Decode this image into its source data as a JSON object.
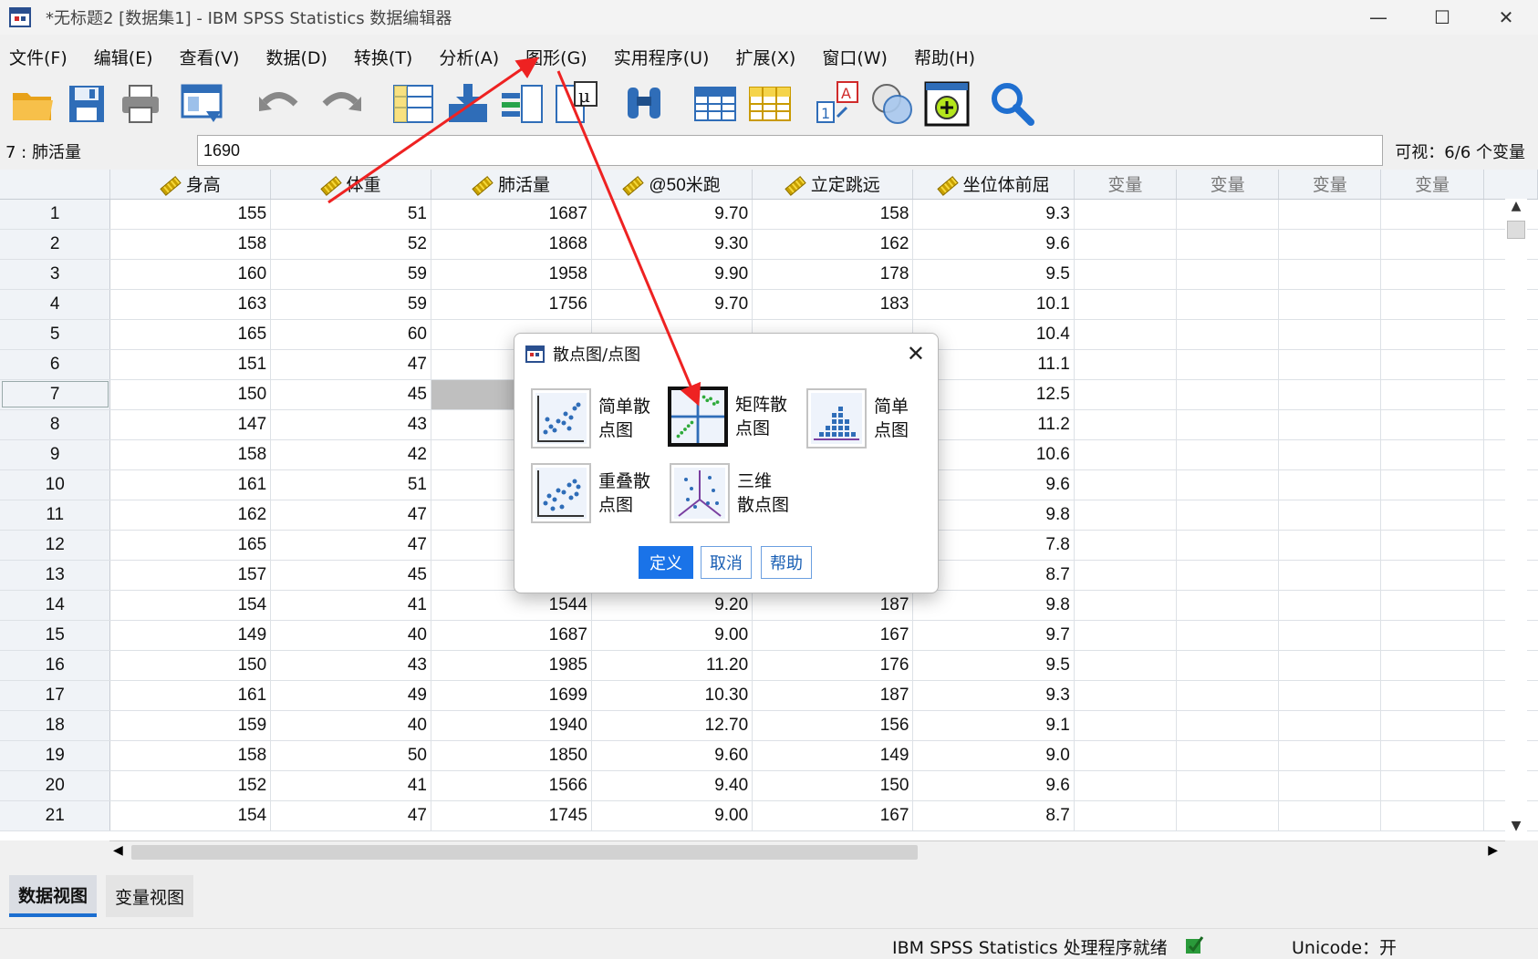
{
  "window": {
    "title": "*无标题2 [数据集1] - IBM SPSS Statistics 数据编辑器",
    "min": "—",
    "max": "☐",
    "close": "✕"
  },
  "menu": [
    "文件(F)",
    "编辑(E)",
    "查看(V)",
    "数据(D)",
    "转换(T)",
    "分析(A)",
    "图形(G)",
    "实用程序(U)",
    "扩展(X)",
    "窗口(W)",
    "帮助(H)"
  ],
  "toolbar_icons": [
    "open-folder-icon",
    "save-icon",
    "print-icon",
    "recall-dialog-icon",
    "undo-icon",
    "redo-icon",
    "goto-case-icon",
    "goto-variable-icon",
    "variables-icon",
    "descriptives-icon",
    "find-icon",
    "insert-cases-icon",
    "insert-variable-icon",
    "split-file-icon",
    "select-cases-icon",
    "value-labels-icon",
    "use-variable-sets-icon",
    "search-icon"
  ],
  "cell_editor": {
    "ref": "7 : 肺活量",
    "value": "1690",
    "visible_vars": "可视：6/6 个变量"
  },
  "columns": [
    "身高",
    "体重",
    "肺活量",
    "@50米跑",
    "立定跳远",
    "坐位体前屈"
  ],
  "empty_column_label": "变量",
  "rows": [
    [
      "1",
      "155",
      "51",
      "1687",
      "9.70",
      "158",
      "9.3"
    ],
    [
      "2",
      "158",
      "52",
      "1868",
      "9.30",
      "162",
      "9.6"
    ],
    [
      "3",
      "160",
      "59",
      "1958",
      "9.90",
      "178",
      "9.5"
    ],
    [
      "4",
      "163",
      "59",
      "1756",
      "9.70",
      "183",
      "10.1"
    ],
    [
      "5",
      "165",
      "60",
      "",
      "",
      "",
      "10.4"
    ],
    [
      "6",
      "151",
      "47",
      "",
      "",
      "",
      "11.1"
    ],
    [
      "7",
      "150",
      "45",
      "",
      "",
      "",
      "12.5"
    ],
    [
      "8",
      "147",
      "43",
      "",
      "",
      "",
      "11.2"
    ],
    [
      "9",
      "158",
      "42",
      "",
      "",
      "",
      "10.6"
    ],
    [
      "10",
      "161",
      "51",
      "",
      "",
      "",
      "9.6"
    ],
    [
      "11",
      "162",
      "47",
      "",
      "",
      "",
      "9.8"
    ],
    [
      "12",
      "165",
      "47",
      "",
      "",
      "",
      "7.8"
    ],
    [
      "13",
      "157",
      "45",
      "",
      "",
      "",
      "8.7"
    ],
    [
      "14",
      "154",
      "41",
      "1544",
      "9.20",
      "187",
      "9.8"
    ],
    [
      "15",
      "149",
      "40",
      "1687",
      "9.00",
      "167",
      "9.7"
    ],
    [
      "16",
      "150",
      "43",
      "1985",
      "11.20",
      "176",
      "9.5"
    ],
    [
      "17",
      "161",
      "49",
      "1699",
      "10.30",
      "187",
      "9.3"
    ],
    [
      "18",
      "159",
      "40",
      "1940",
      "12.70",
      "156",
      "9.1"
    ],
    [
      "19",
      "158",
      "50",
      "1850",
      "9.60",
      "149",
      "9.0"
    ],
    [
      "20",
      "152",
      "41",
      "1566",
      "9.40",
      "150",
      "9.6"
    ],
    [
      "21",
      "154",
      "47",
      "1745",
      "9.00",
      "167",
      "8.7"
    ]
  ],
  "tabs": {
    "data_view": "数据视图",
    "variable_view": "变量视图"
  },
  "status": {
    "processor": "IBM SPSS Statistics 处理程序就绪",
    "unicode": "Unicode：开"
  },
  "dialog": {
    "title": "散点图/点图",
    "options": [
      {
        "label": "简单散点图",
        "line1": "简单散",
        "line2": "点图"
      },
      {
        "label": "矩阵散点图",
        "line1": "矩阵散",
        "line2": "点图",
        "selected": true
      },
      {
        "label": "简单点图",
        "line1": "简单",
        "line2": "点图"
      },
      {
        "label": "重叠散点图",
        "line1": "重叠散",
        "line2": "点图"
      },
      {
        "label": "三维散点图",
        "line1": "三维",
        "line2": "散点图"
      }
    ],
    "buttons": {
      "define": "定义",
      "cancel": "取消",
      "help": "帮助"
    }
  },
  "colors": {
    "accent": "#1a73e8",
    "annotation_arrow": "#ee2222",
    "header_bg": "#f0f3f7"
  }
}
